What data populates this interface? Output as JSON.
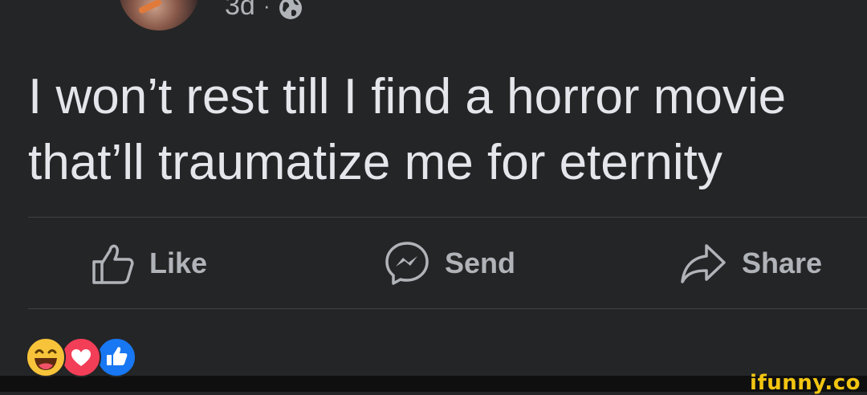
{
  "post": {
    "time_ago": "3d",
    "separator": "·",
    "privacy_icon": "globe-icon",
    "text_lines": [
      "I won’t rest till I find a horror movie",
      "that’ll traumatize me for eternity"
    ]
  },
  "actions": [
    {
      "label": "Like",
      "icon": "thumbs-up-icon"
    },
    {
      "label": "Send",
      "icon": "messenger-icon"
    },
    {
      "label": "Share",
      "icon": "share-arrow-icon"
    }
  ],
  "reactions": [
    "haha",
    "love",
    "like"
  ],
  "watermark": "ifunny.co",
  "colors": {
    "background": "#242526",
    "text": "#e4e6eb",
    "secondary": "#b0b3b8",
    "like_blue": "#1877f2",
    "love_red": "#f33e58",
    "haha_yellow": "#f7c33a",
    "watermark": "#f2c511"
  }
}
